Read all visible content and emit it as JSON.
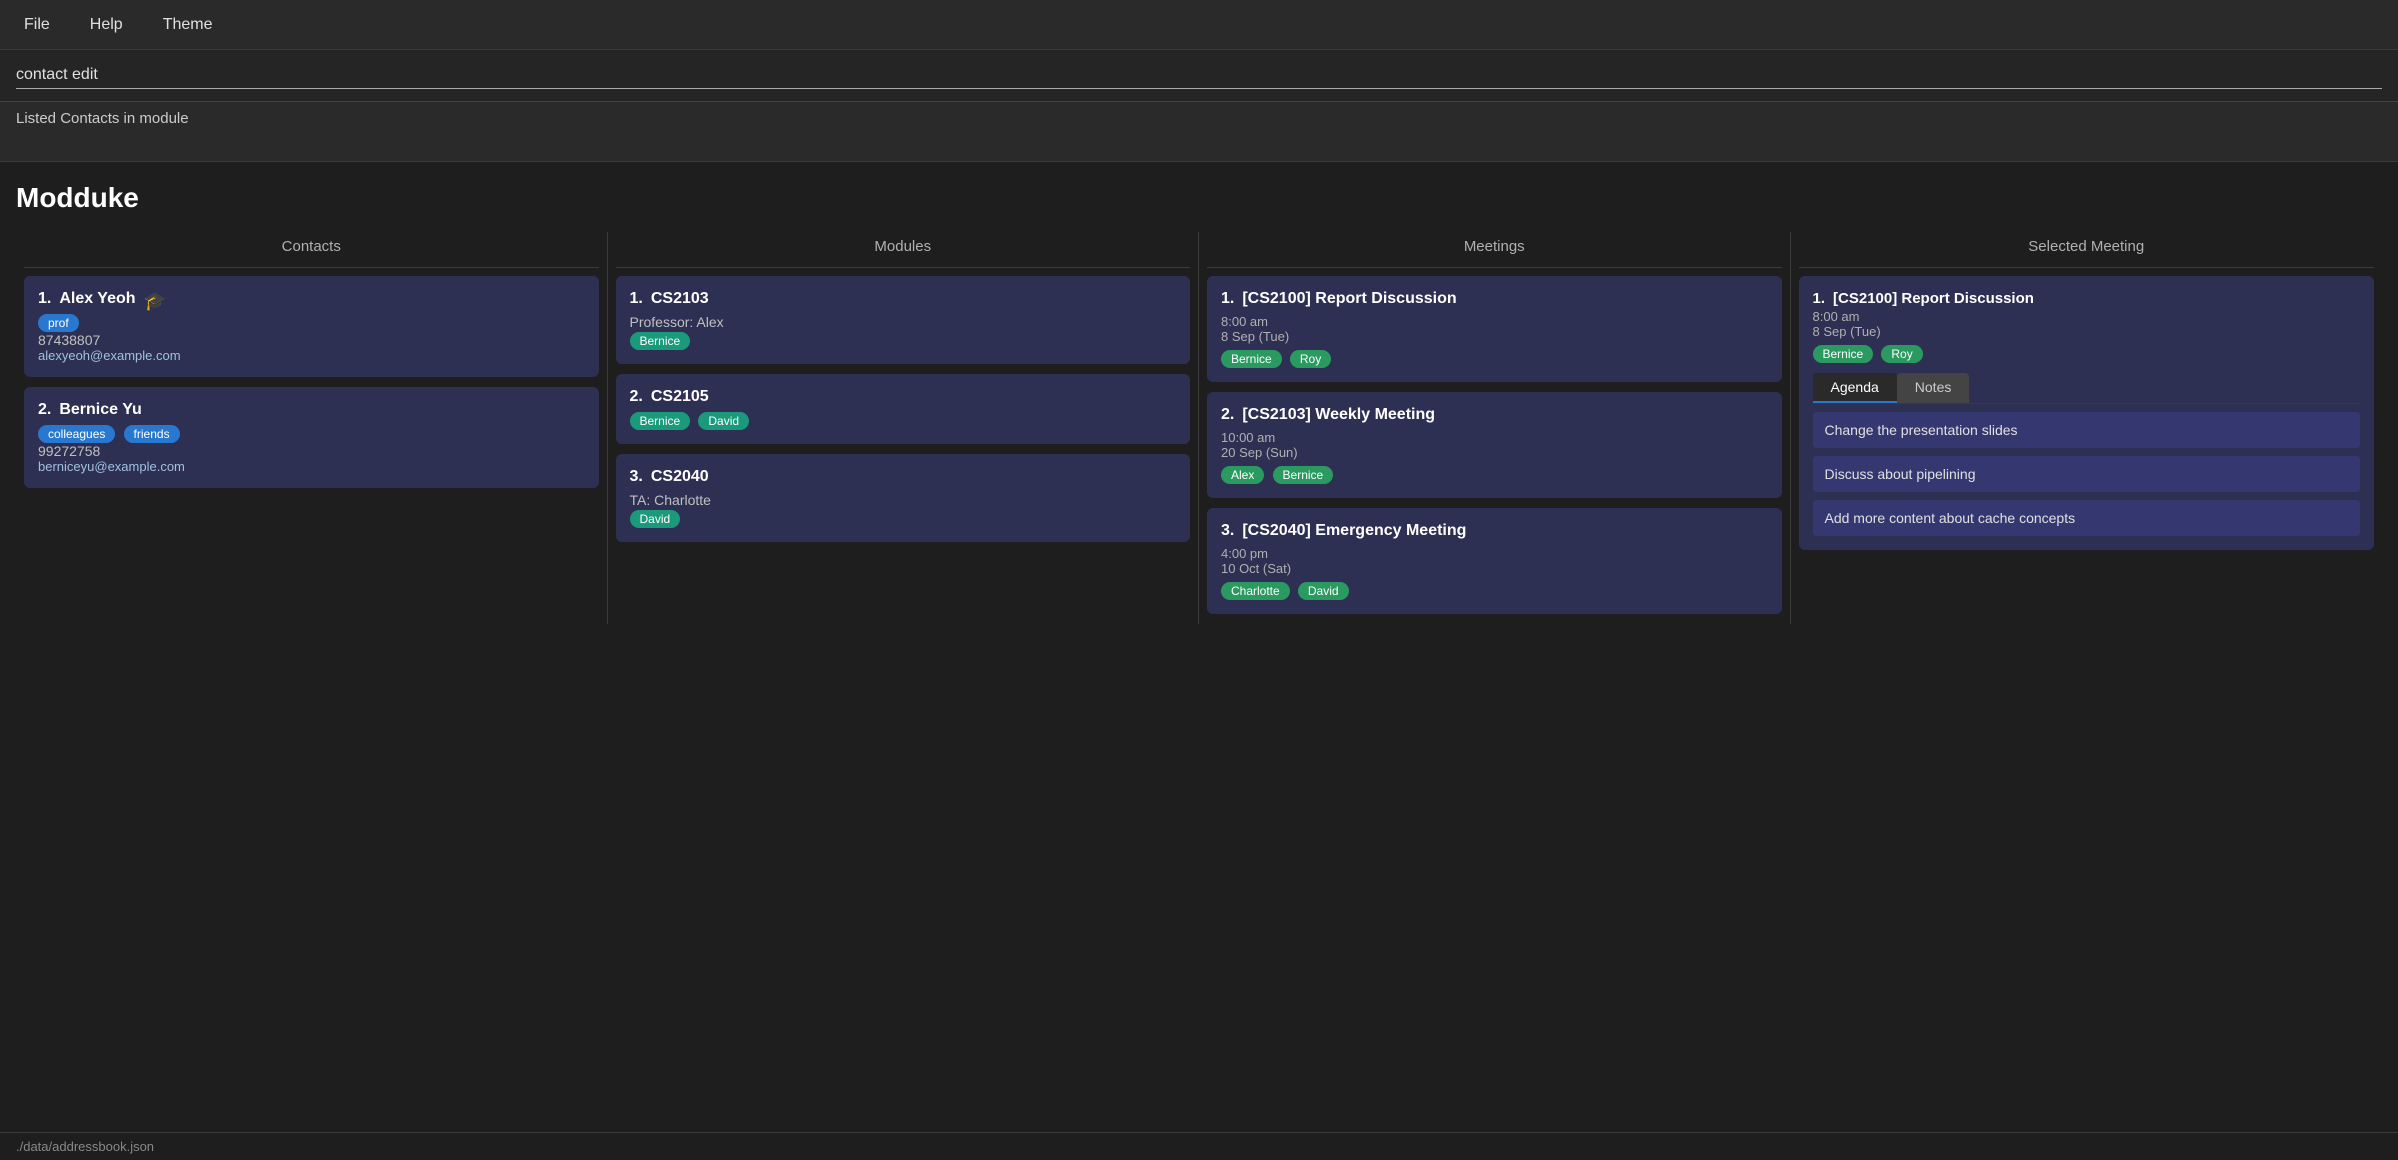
{
  "menubar": {
    "items": [
      {
        "label": "File",
        "id": "file"
      },
      {
        "label": "Help",
        "id": "help"
      },
      {
        "label": "Theme",
        "id": "theme"
      }
    ]
  },
  "command": {
    "value": "contact edit",
    "placeholder": ""
  },
  "status": {
    "text": "Listed Contacts in module"
  },
  "app": {
    "title": "Modduke"
  },
  "columns": {
    "contacts": {
      "header": "Contacts",
      "items": [
        {
          "index": "1.",
          "name": "Alex Yeoh",
          "icon": "🎓",
          "tags": [
            {
              "label": "prof",
              "type": "blue"
            }
          ],
          "phone": "87438807",
          "email": "alexyeoh@example.com"
        },
        {
          "index": "2.",
          "name": "Bernice Yu",
          "icon": "",
          "tags": [
            {
              "label": "colleagues",
              "type": "blue"
            },
            {
              "label": "friends",
              "type": "blue"
            }
          ],
          "phone": "99272758",
          "email": "berniceyu@example.com"
        }
      ]
    },
    "modules": {
      "header": "Modules",
      "items": [
        {
          "index": "1.",
          "code": "CS2103",
          "role": "Professor: Alex",
          "tags": [
            {
              "label": "Bernice",
              "type": "teal"
            }
          ]
        },
        {
          "index": "2.",
          "code": "CS2105",
          "role": "",
          "tags": [
            {
              "label": "Bernice",
              "type": "teal"
            },
            {
              "label": "David",
              "type": "teal"
            }
          ]
        },
        {
          "index": "3.",
          "code": "CS2040",
          "role": "TA: Charlotte",
          "tags": [
            {
              "label": "David",
              "type": "teal"
            }
          ]
        }
      ]
    },
    "meetings": {
      "header": "Meetings",
      "items": [
        {
          "index": "1.",
          "title": "[CS2100] Report Discussion",
          "time": "8:00 am",
          "date": "8 Sep (Tue)",
          "tags": [
            {
              "label": "Bernice",
              "type": "green"
            },
            {
              "label": "Roy",
              "type": "green"
            }
          ]
        },
        {
          "index": "2.",
          "title": "[CS2103] Weekly Meeting",
          "time": "10:00 am",
          "date": "20 Sep (Sun)",
          "tags": [
            {
              "label": "Alex",
              "type": "green"
            },
            {
              "label": "Bernice",
              "type": "green"
            }
          ]
        },
        {
          "index": "3.",
          "title": "[CS2040] Emergency Meeting",
          "time": "4:00 pm",
          "date": "10 Oct (Sat)",
          "tags": [
            {
              "label": "Charlotte",
              "type": "green"
            },
            {
              "label": "David",
              "type": "green"
            }
          ]
        }
      ]
    },
    "selected_meeting": {
      "header": "Selected Meeting",
      "title": "[CS2100] Report Discussion",
      "time": "8:00 am",
      "date": "8 Sep (Tue)",
      "tags": [
        {
          "label": "Bernice",
          "type": "green"
        },
        {
          "label": "Roy",
          "type": "green"
        }
      ],
      "tabs": [
        {
          "label": "Agenda",
          "active": true
        },
        {
          "label": "Notes",
          "active": false
        }
      ],
      "agenda_items": [
        "Change the presentation slides",
        "Discuss about pipelining",
        "Add more content about cache concepts"
      ]
    }
  },
  "footer": {
    "text": "./data/addressbook.json"
  }
}
